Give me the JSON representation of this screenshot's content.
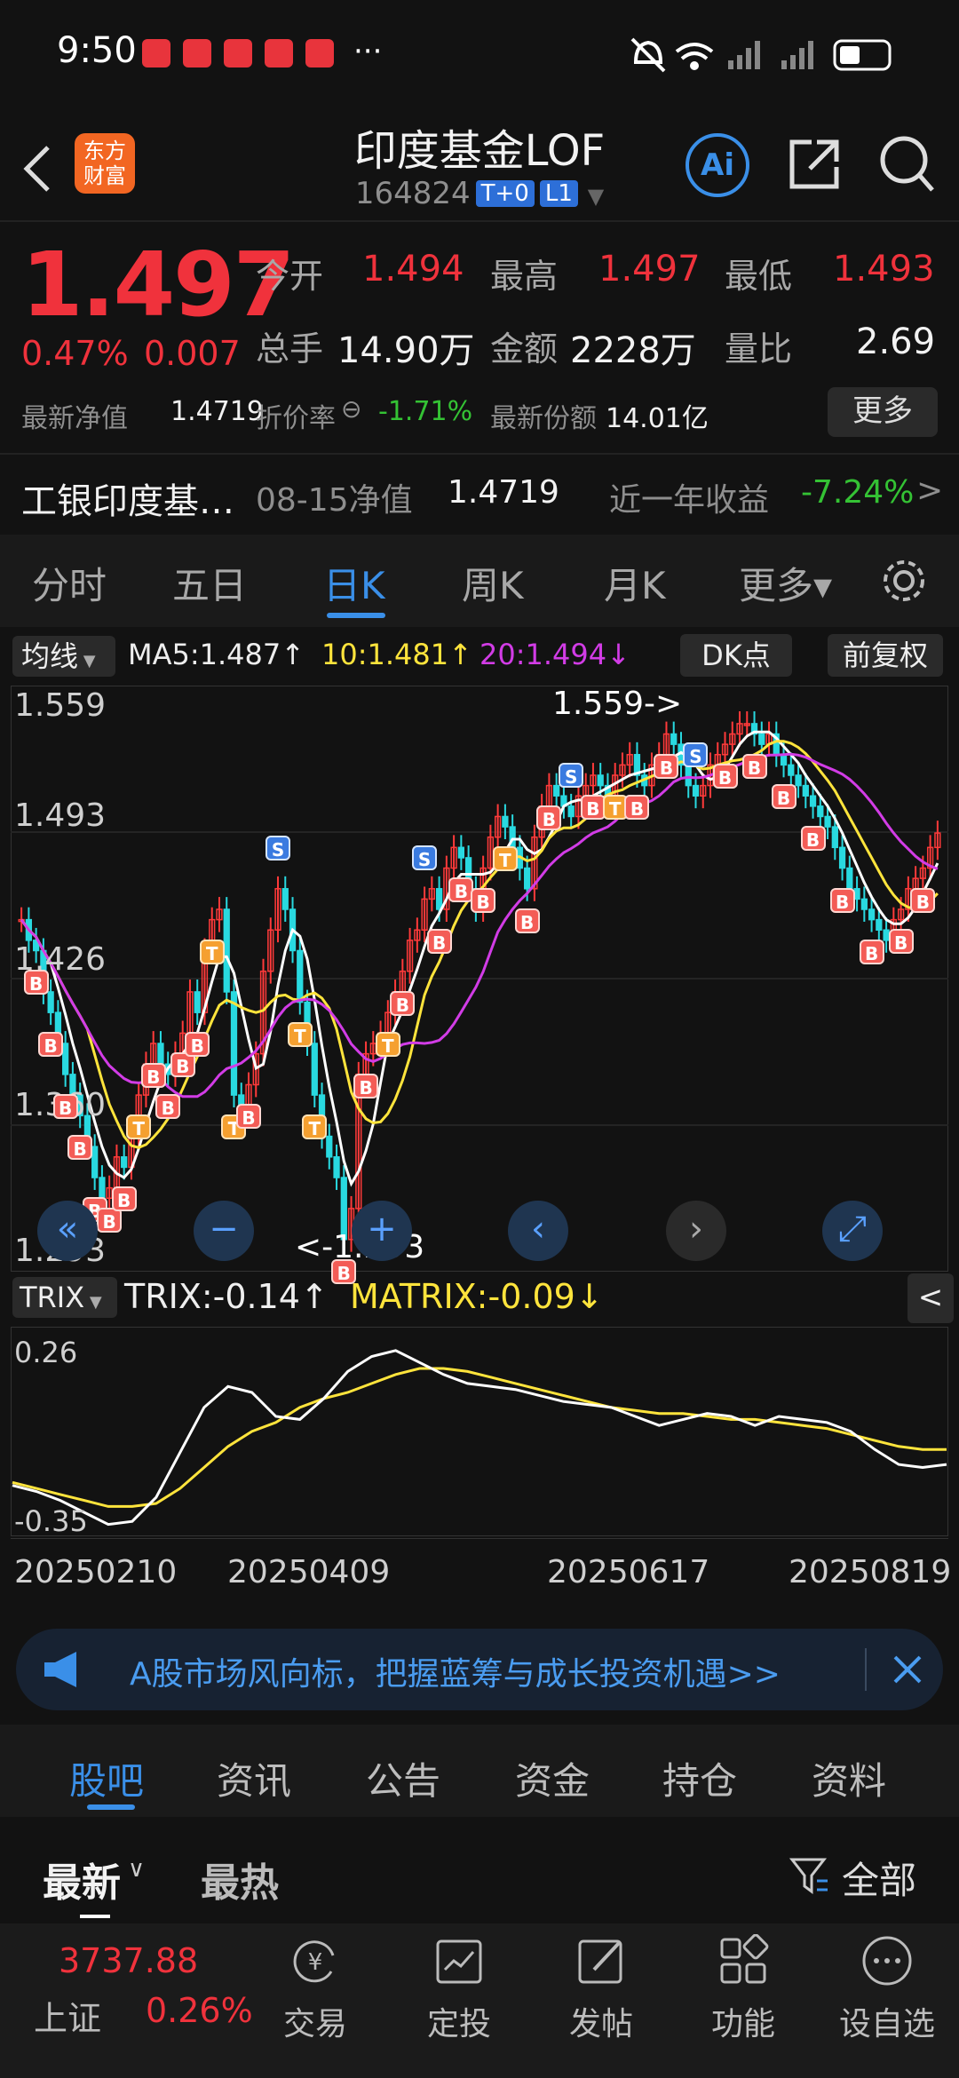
{
  "status": {
    "time": "9:50",
    "more": "···"
  },
  "header": {
    "back_icon": "chevron-left-icon",
    "logo_text": "东方\n财富",
    "title": "印度基金LOF",
    "code": "164824",
    "tag1": "T+0",
    "tag2": "L1",
    "ai_label": "Ai"
  },
  "quote": {
    "price": "1.497",
    "change_pct": "0.47%",
    "change": "0.007",
    "open_label": "今开",
    "open": "1.494",
    "high_label": "最高",
    "high": "1.497",
    "low_label": "最低",
    "low": "1.493",
    "vol_label": "总手",
    "vol": "14.90万",
    "amount_label": "金额",
    "amount": "2228万",
    "ratio_label": "量比",
    "ratio": "2.69",
    "nav_label": "最新净值",
    "nav": "1.4719",
    "discount_label": "折价率",
    "discount": "-1.71%",
    "shares_label": "最新份额",
    "shares": "14.01亿",
    "more_button": "更多"
  },
  "fund_row": {
    "name": "工银印度基…",
    "nav_date_label": "08-15净值",
    "nav_value": "1.4719",
    "year_label": "近一年收益",
    "year_value": "-7.24%",
    "arrow": ">"
  },
  "chart_tabs": [
    {
      "label": "分时"
    },
    {
      "label": "五日"
    },
    {
      "label": "日K",
      "active": true
    },
    {
      "label": "周K"
    },
    {
      "label": "月K"
    },
    {
      "label": "更多▾"
    }
  ],
  "ma_bar": {
    "selector": "均线",
    "ma5": "MA5:1.487↑",
    "ma10": "10:1.481↑",
    "ma20": "20:1.494↓",
    "dk_button": "DK点",
    "adjust_button": "前复权"
  },
  "kline": {
    "y_labels": [
      "1.559",
      "1.493",
      "1.426",
      "1.360",
      "1.293"
    ],
    "max_annot": "1.559->",
    "min_annot": "<-1.293"
  },
  "trix_bar": {
    "selector": "TRIX",
    "trix": "TRIX:-0.14↑",
    "matrix": "MATRIX:-0.09↓",
    "collapse": "<"
  },
  "trix_axis": {
    "top": "0.26",
    "bottom": "-0.35"
  },
  "dates": [
    "20250210",
    "20250409",
    "20250617",
    "20250819"
  ],
  "banner": {
    "text": "A股市场风向标，把握蓝筹与成长投资机遇>>"
  },
  "bottom_tabs": [
    {
      "label": "股吧",
      "active": true
    },
    {
      "label": "资讯"
    },
    {
      "label": "公告"
    },
    {
      "label": "资金"
    },
    {
      "label": "持仓"
    },
    {
      "label": "资料"
    }
  ],
  "feed_sort": {
    "latest": "最新",
    "hot": "最热",
    "filter": "全部"
  },
  "index": {
    "value": "3737.88",
    "name": "上证",
    "pct": "0.26%"
  },
  "dock": [
    {
      "label": "交易",
      "icon": "yen-exchange-icon"
    },
    {
      "label": "定投",
      "icon": "calendar-chart-icon"
    },
    {
      "label": "发帖",
      "icon": "edit-post-icon"
    },
    {
      "label": "功能",
      "icon": "grid-icon"
    },
    {
      "label": "设自选",
      "icon": "more-circle-icon"
    }
  ],
  "chart_data": {
    "type": "candlestick",
    "y_range": [
      1.293,
      1.559
    ],
    "closes": [
      1.455,
      1.445,
      1.44,
      1.42,
      1.41,
      1.395,
      1.38,
      1.37,
      1.36,
      1.345,
      1.33,
      1.32,
      1.325,
      1.34,
      1.335,
      1.35,
      1.37,
      1.385,
      1.395,
      1.385,
      1.38,
      1.39,
      1.4,
      1.42,
      1.41,
      1.44,
      1.455,
      1.46,
      1.42,
      1.37,
      1.36,
      1.375,
      1.39,
      1.43,
      1.45,
      1.47,
      1.46,
      1.44,
      1.415,
      1.395,
      1.37,
      1.35,
      1.34,
      1.33,
      1.3,
      1.315,
      1.38,
      1.39,
      1.395,
      1.4,
      1.41,
      1.42,
      1.43,
      1.445,
      1.45,
      1.465,
      1.47,
      1.46,
      1.48,
      1.49,
      1.485,
      1.47,
      1.46,
      1.48,
      1.495,
      1.505,
      1.5,
      1.49,
      1.48,
      1.47,
      1.495,
      1.51,
      1.52,
      1.515,
      1.51,
      1.505,
      1.515,
      1.52,
      1.525,
      1.52,
      1.515,
      1.525,
      1.53,
      1.535,
      1.525,
      1.52,
      1.53,
      1.535,
      1.545,
      1.54,
      1.53,
      1.52,
      1.515,
      1.52,
      1.53,
      1.535,
      1.54,
      1.545,
      1.55,
      1.55,
      1.545,
      1.54,
      1.545,
      1.535,
      1.53,
      1.525,
      1.52,
      1.515,
      1.51,
      1.505,
      1.5,
      1.49,
      1.48,
      1.47,
      1.465,
      1.46,
      1.455,
      1.45,
      1.445,
      1.455,
      1.46,
      1.47,
      1.475,
      1.48,
      1.49,
      1.497
    ],
    "ma5": {
      "last": 1.487
    },
    "ma10": {
      "last": 1.481
    },
    "ma20": {
      "last": 1.494
    },
    "trix": {
      "range": [
        -0.35,
        0.26
      ],
      "values": [
        -0.21,
        -0.23,
        -0.26,
        -0.3,
        -0.34,
        -0.33,
        -0.25,
        -0.1,
        0.05,
        0.12,
        0.1,
        0.02,
        0.01,
        0.08,
        0.17,
        0.22,
        0.24,
        0.2,
        0.16,
        0.13,
        0.12,
        0.11,
        0.09,
        0.07,
        0.06,
        0.05,
        0.02,
        -0.01,
        0.01,
        0.03,
        0.02,
        -0.01,
        0.02,
        0.01,
        0.0,
        -0.03,
        -0.09,
        -0.14,
        -0.15,
        -0.14
      ]
    },
    "matrix": {
      "values": [
        -0.2,
        -0.22,
        -0.24,
        -0.26,
        -0.28,
        -0.28,
        -0.27,
        -0.22,
        -0.15,
        -0.08,
        -0.03,
        0.0,
        0.05,
        0.08,
        0.1,
        0.13,
        0.16,
        0.18,
        0.18,
        0.17,
        0.15,
        0.13,
        0.11,
        0.09,
        0.07,
        0.05,
        0.04,
        0.03,
        0.03,
        0.02,
        0.01,
        0.01,
        0.0,
        -0.01,
        -0.02,
        -0.04,
        -0.06,
        -0.08,
        -0.09,
        -0.09
      ]
    },
    "x_ticks": [
      "20250210",
      "20250409",
      "20250617",
      "20250819"
    ]
  }
}
